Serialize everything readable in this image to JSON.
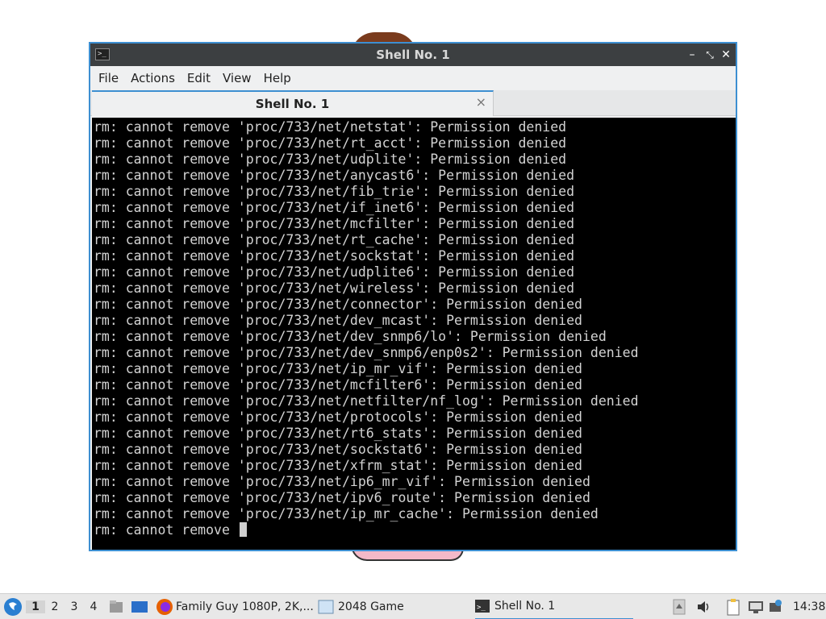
{
  "window": {
    "title": "Shell No. 1",
    "menu": [
      "File",
      "Actions",
      "Edit",
      "View",
      "Help"
    ],
    "tab_label": "Shell No. 1",
    "tab_close": "×"
  },
  "terminal": {
    "lines": [
      "rm: cannot remove 'proc/733/net/netstat': Permission denied",
      "rm: cannot remove 'proc/733/net/rt_acct': Permission denied",
      "rm: cannot remove 'proc/733/net/udplite': Permission denied",
      "rm: cannot remove 'proc/733/net/anycast6': Permission denied",
      "rm: cannot remove 'proc/733/net/fib_trie': Permission denied",
      "rm: cannot remove 'proc/733/net/if_inet6': Permission denied",
      "rm: cannot remove 'proc/733/net/mcfilter': Permission denied",
      "rm: cannot remove 'proc/733/net/rt_cache': Permission denied",
      "rm: cannot remove 'proc/733/net/sockstat': Permission denied",
      "rm: cannot remove 'proc/733/net/udplite6': Permission denied",
      "rm: cannot remove 'proc/733/net/wireless': Permission denied",
      "rm: cannot remove 'proc/733/net/connector': Permission denied",
      "rm: cannot remove 'proc/733/net/dev_mcast': Permission denied",
      "rm: cannot remove 'proc/733/net/dev_snmp6/lo': Permission denied",
      "rm: cannot remove 'proc/733/net/dev_snmp6/enp0s2': Permission denied",
      "rm: cannot remove 'proc/733/net/ip_mr_vif': Permission denied",
      "rm: cannot remove 'proc/733/net/mcfilter6': Permission denied",
      "rm: cannot remove 'proc/733/net/netfilter/nf_log': Permission denied",
      "rm: cannot remove 'proc/733/net/protocols': Permission denied",
      "rm: cannot remove 'proc/733/net/rt6_stats': Permission denied",
      "rm: cannot remove 'proc/733/net/sockstat6': Permission denied",
      "rm: cannot remove 'proc/733/net/xfrm_stat': Permission denied",
      "rm: cannot remove 'proc/733/net/ip6_mr_vif': Permission denied",
      "rm: cannot remove 'proc/733/net/ipv6_route': Permission denied",
      "rm: cannot remove 'proc/733/net/ip_mr_cache': Permission denied"
    ],
    "prompt_line": "rm: cannot remove "
  },
  "taskbar": {
    "workspaces": [
      "1",
      "2",
      "3",
      "4"
    ],
    "active_workspace": "1",
    "tasks": [
      {
        "label": "Family Guy 1080P, 2K,...",
        "icon": "firefox-icon"
      },
      {
        "label": "2048 Game",
        "icon": "window-icon"
      },
      {
        "label": "Shell No. 1",
        "icon": "terminal-icon"
      }
    ],
    "clock": "14:38"
  },
  "colors": {
    "accent": "#3d8fd1",
    "terminal_bg": "#000000",
    "terminal_fg": "#d3d3d3",
    "titlebar": "#3c3f41"
  }
}
